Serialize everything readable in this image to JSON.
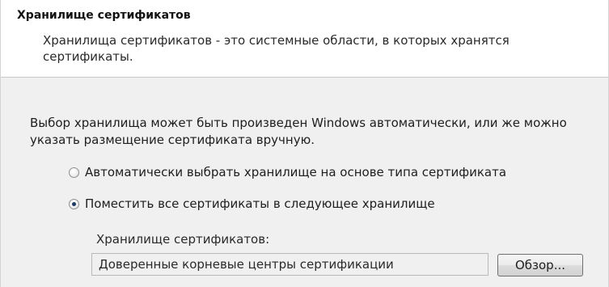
{
  "header": {
    "title": "Хранилище сертификатов",
    "description": "Хранилища сертификатов - это системные области, в которых хранятся сертификаты."
  },
  "main": {
    "intro": "Выбор хранилища может быть произведен Windows автоматически, или же можно указать размещение сертификата вручную.",
    "options": [
      {
        "label": "Автоматически выбрать хранилище на основе типа сертификата",
        "selected": false
      },
      {
        "label": "Поместить все сертификаты в следующее хранилище",
        "selected": true
      }
    ],
    "store_label": "Хранилище сертификатов:",
    "store_value": "Доверенные корневые центры сертификации",
    "browse_label": "Обзор..."
  }
}
